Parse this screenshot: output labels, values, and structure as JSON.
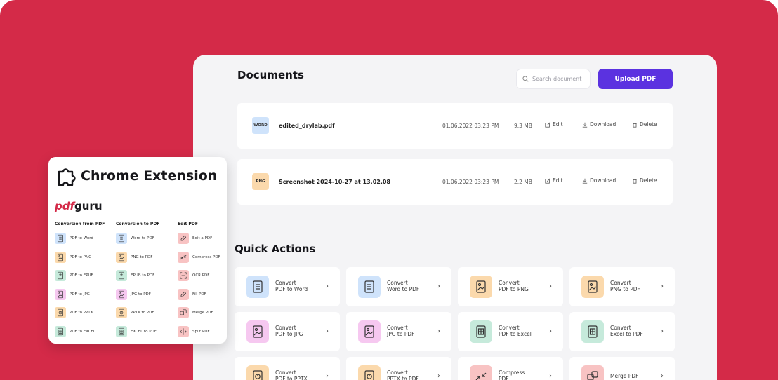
{
  "documents": {
    "title": "Documents",
    "search_placeholder": "Search document",
    "upload_label": "Upload PDF",
    "rows": [
      {
        "type": "WORD",
        "type_color": "#cfe3fb",
        "name": "edited_drylab.pdf",
        "date": "01.06.2022 03:23 PM",
        "size": "9.3 MB",
        "edit": "Edit",
        "download": "Download",
        "delete": "Delete"
      },
      {
        "type": "PNG",
        "type_color": "#fbd9ac",
        "name": "Screenshot 2024-10-27 at 13.02.08",
        "date": "01.06.2022 03:23 PM",
        "size": "2.2 MB",
        "edit": "Edit",
        "download": "Download",
        "delete": "Delete"
      }
    ]
  },
  "quick_actions": {
    "title": "Quick Actions",
    "tiles": [
      {
        "line1": "Convert",
        "line2": "PDF to Word",
        "icon": "document-icon",
        "color": "#cfe3fb"
      },
      {
        "line1": "Convert",
        "line2": "Word to PDF",
        "icon": "document-icon",
        "color": "#cfe3fb"
      },
      {
        "line1": "Convert",
        "line2": "PDF to PNG",
        "icon": "image-icon",
        "color": "#fbd9ac"
      },
      {
        "line1": "Convert",
        "line2": "PNG to PDF",
        "icon": "image-icon",
        "color": "#fbd9ac"
      },
      {
        "line1": "Convert",
        "line2": "PDF to JPG",
        "icon": "image-icon",
        "color": "#f6c8f0"
      },
      {
        "line1": "Convert",
        "line2": "JPG to PDF",
        "icon": "image-icon",
        "color": "#f6c8f0"
      },
      {
        "line1": "Convert",
        "line2": "PDF to Excel",
        "icon": "table-icon",
        "color": "#c6eadb"
      },
      {
        "line1": "Convert",
        "line2": "Excel to PDF",
        "icon": "table-icon",
        "color": "#c6eadb"
      },
      {
        "line1": "Convert",
        "line2": "PDF to PPTX",
        "icon": "presentation-icon",
        "color": "#fbd9ac"
      },
      {
        "line1": "Convert",
        "line2": "PPTX to PDF",
        "icon": "presentation-icon",
        "color": "#fbd9ac"
      },
      {
        "line1": "Compress",
        "line2": "PDF",
        "icon": "compress-icon",
        "color": "#f8c3c3"
      },
      {
        "line1": "Merge PDF",
        "line2": "",
        "icon": "merge-icon",
        "color": "#f8c3c3"
      }
    ]
  },
  "extension": {
    "title": "Chrome Extension",
    "logo_pdf": "pdf",
    "logo_guru": "guru",
    "columns": [
      {
        "heading": "Conversion from PDF",
        "items": [
          {
            "label": "PDF to Word",
            "color": "#cfe3fb",
            "icon": "document-icon"
          },
          {
            "label": "PDF to PNG",
            "color": "#fbd9ac",
            "icon": "image-icon"
          },
          {
            "label": "PDF to EPUB",
            "color": "#c6eadb",
            "icon": "book-icon"
          },
          {
            "label": "PDF to JPG",
            "color": "#f6c8f0",
            "icon": "image-icon"
          },
          {
            "label": "PDF to PPTX",
            "color": "#fbd9ac",
            "icon": "presentation-icon"
          },
          {
            "label": "PDF to EXCEL",
            "color": "#c6eadb",
            "icon": "table-icon"
          }
        ]
      },
      {
        "heading": "Conversion to PDF",
        "items": [
          {
            "label": "Word to PDF",
            "color": "#cfe3fb",
            "icon": "document-icon"
          },
          {
            "label": "PNG to PDF",
            "color": "#fbd9ac",
            "icon": "image-icon"
          },
          {
            "label": "EPUB to PDF",
            "color": "#c6eadb",
            "icon": "book-icon"
          },
          {
            "label": "JPG to PDF",
            "color": "#f6c8f0",
            "icon": "image-icon"
          },
          {
            "label": "PPTX to PDF",
            "color": "#fbd9ac",
            "icon": "presentation-icon"
          },
          {
            "label": "EXCEL to PDF",
            "color": "#c6eadb",
            "icon": "table-icon"
          }
        ]
      },
      {
        "heading": "Edit PDF",
        "items": [
          {
            "label": "Edit a PDF",
            "color": "#f8c3c3",
            "icon": "pencil-icon"
          },
          {
            "label": "Compress PDF",
            "color": "#f8c3c3",
            "icon": "compress-icon"
          },
          {
            "label": "OCR PDF",
            "color": "#f8c3c3",
            "icon": "ocr-icon"
          },
          {
            "label": "Fill PDF",
            "color": "#f8c3c3",
            "icon": "pencil-icon"
          },
          {
            "label": "Merge PDF",
            "color": "#f8c3c3",
            "icon": "merge-icon"
          },
          {
            "label": "Split PDF",
            "color": "#f8c3c3",
            "icon": "split-icon"
          }
        ]
      }
    ]
  },
  "colors": {
    "background": "#d42a48",
    "accent": "#5b32e0",
    "window": "#f4f4f6"
  }
}
